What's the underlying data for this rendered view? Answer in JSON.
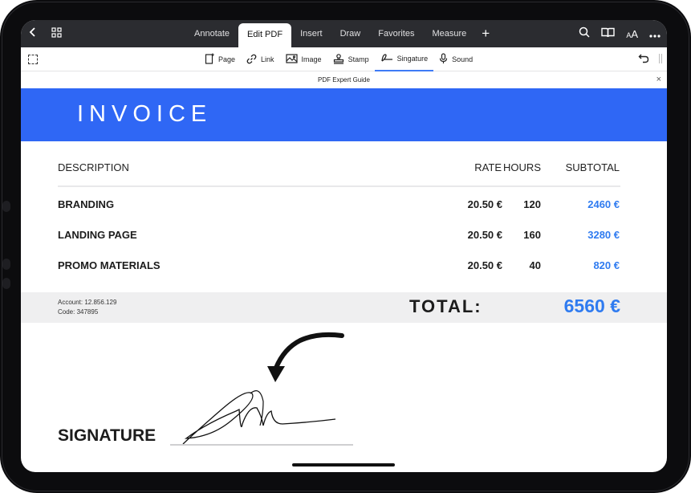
{
  "topbar": {
    "tabs": [
      {
        "label": "Annotate"
      },
      {
        "label": "Edit PDF"
      },
      {
        "label": "Insert"
      },
      {
        "label": "Draw"
      },
      {
        "label": "Favorites"
      },
      {
        "label": "Measure"
      }
    ],
    "active_tab": "Edit PDF",
    "add_tab": "+",
    "text_size_label": "AA"
  },
  "tools": {
    "items": [
      {
        "label": "Page",
        "icon": "page-icon"
      },
      {
        "label": "Link",
        "icon": "link-icon"
      },
      {
        "label": "Image",
        "icon": "image-icon"
      },
      {
        "label": "Stamp",
        "icon": "stamp-icon"
      },
      {
        "label": "Singature",
        "icon": "signature-icon"
      },
      {
        "label": "Sound",
        "icon": "microphone-icon"
      }
    ],
    "active": "Singature"
  },
  "document": {
    "title": "PDF Expert Guide",
    "close": "×"
  },
  "invoice": {
    "heading": "INVOICE",
    "columns": {
      "description": "DESCRIPTION",
      "rate": "RATE",
      "hours": "HOURS",
      "subtotal": "SUBTOTAL"
    },
    "rows": [
      {
        "description": "BRANDING",
        "rate": "20.50 €",
        "hours": "120",
        "subtotal": "2460 €"
      },
      {
        "description": "LANDING PAGE",
        "rate": "20.50 €",
        "hours": "160",
        "subtotal": "3280 €"
      },
      {
        "description": "PROMO MATERIALS",
        "rate": "20.50 €",
        "hours": "40",
        "subtotal": "820 €"
      }
    ],
    "account": "Account: 12.856.129",
    "code": "Code: 347895",
    "total_label": "TOTAL:",
    "total_value": "6560 €",
    "signature_label": "SIGNATURE"
  },
  "colors": {
    "accent": "#2f67f5",
    "link_blue": "#2f7bf0",
    "toolbar_dark": "#2b2c30"
  }
}
